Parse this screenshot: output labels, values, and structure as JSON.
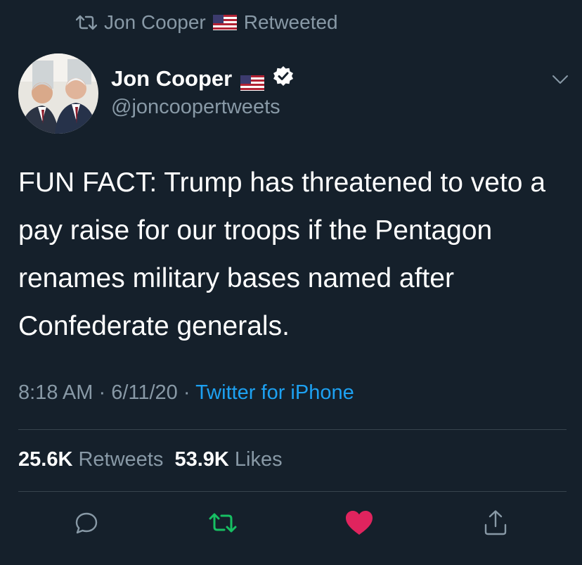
{
  "retweet_context": {
    "icon": "retweet-icon",
    "name": "Jon Cooper",
    "label": "Retweeted"
  },
  "author": {
    "name": "Jon Cooper",
    "handle": "@joncoopertweets",
    "verified_icon": "verified-badge-icon",
    "flag_icon": "us-flag-icon"
  },
  "tweet": {
    "text": "FUN FACT: Trump has threatened to veto a pay raise for our troops if the Pentagon renames military bases named after Confederate generals.",
    "time": "8:18 AM",
    "date": "6/11/20",
    "source": "Twitter for iPhone"
  },
  "stats": {
    "retweets_count": "25.6K",
    "retweets_label": "Retweets",
    "likes_count": "53.9K",
    "likes_label": "Likes"
  },
  "actions": [
    "reply-icon",
    "retweet-icon",
    "like-icon",
    "share-icon"
  ],
  "colors": {
    "background": "#15202b",
    "secondary_text": "#8899a6",
    "link": "#1da1f2",
    "retweet_active": "#17bf63",
    "like_active": "#e0245e",
    "divider": "#38444d"
  }
}
